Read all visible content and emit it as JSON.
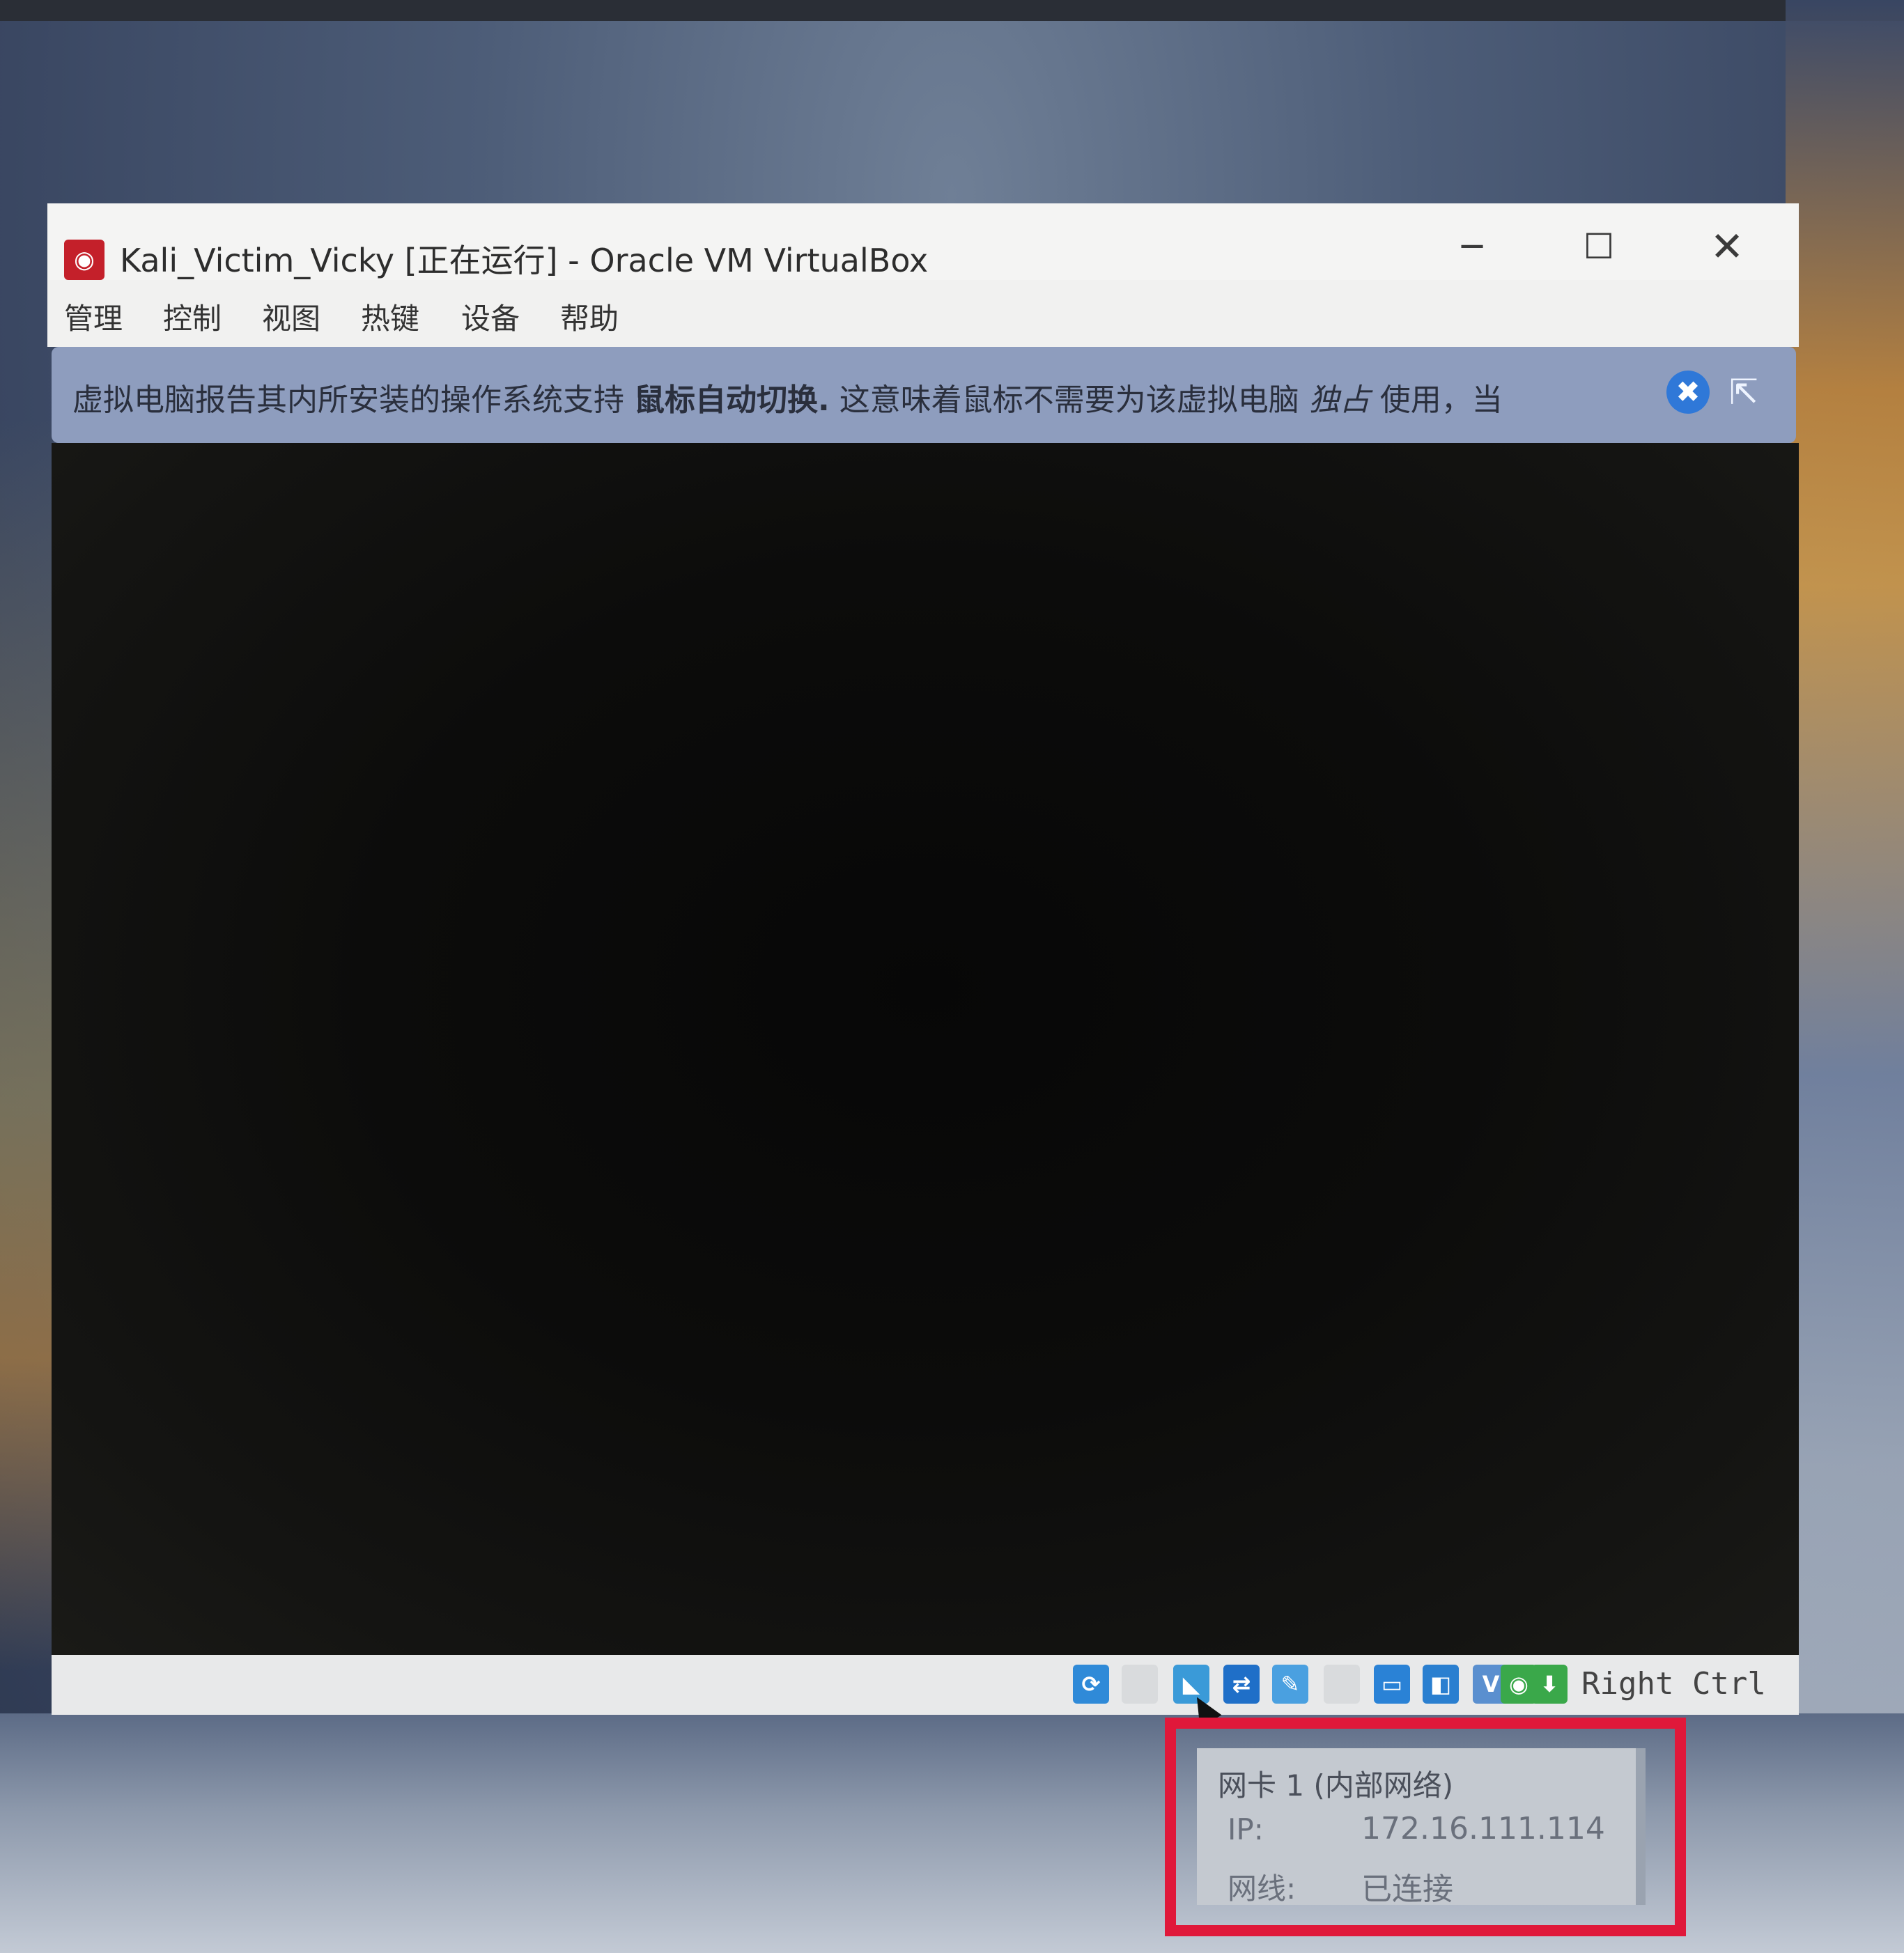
{
  "window": {
    "title": "Kali_Victim_Vicky [正在运行] - Oracle VM VirtualBox",
    "app_icon": "virtualbox-icon",
    "controls": {
      "minimize": "─",
      "maximize": "☐",
      "close": "✕"
    }
  },
  "menu": {
    "items": [
      "管理",
      "控制",
      "视图",
      "热键",
      "设备",
      "帮助"
    ]
  },
  "notice": {
    "text_part1": "虚拟电脑报告其内所安装的操作系统支持 ",
    "text_bold": "鼠标自动切换.",
    "text_part2": " 这意味着鼠标不需要为该虚拟电脑 ",
    "text_italic": "独占",
    "text_part3": " 使用，当",
    "close_glyph": "✖",
    "mouse_glyph": "⇱"
  },
  "status_bar": {
    "icons": [
      {
        "name": "hard-disk-icon",
        "glyph": "⟳",
        "color": "#2f8ad8"
      },
      {
        "name": "optical-drive-icon",
        "glyph": "",
        "color": "#d9dbdd"
      },
      {
        "name": "audio-icon",
        "glyph": "◣",
        "color": "#3a9ad8"
      },
      {
        "name": "network-icon",
        "glyph": "⇄",
        "color": "#1f6fc8"
      },
      {
        "name": "usb-icon",
        "glyph": "✎",
        "color": "#4aa0e0"
      },
      {
        "name": "shared-folders-icon",
        "glyph": "",
        "color": "#d9dbdd"
      },
      {
        "name": "display-icon",
        "glyph": "▭",
        "color": "#2a82d6"
      },
      {
        "name": "video-capture-icon",
        "glyph": "◧",
        "color": "#2a7fd0"
      },
      {
        "name": "virtualization-icon",
        "glyph": "V",
        "color": "#5a8fcf"
      },
      {
        "name": "globe-icon",
        "glyph": "◉",
        "color": "#3aa84a"
      },
      {
        "name": "download-icon",
        "glyph": "⬇",
        "color": "#3aa84a"
      }
    ],
    "host_key": "Right Ctrl"
  },
  "tooltip": {
    "title": "网卡 1 (内部网络)",
    "ip_label": "IP:",
    "ip_value": "172.16.111.114",
    "cable_label": "网线:",
    "cable_value": "已连接",
    "highlight_color": "#e0183a"
  }
}
